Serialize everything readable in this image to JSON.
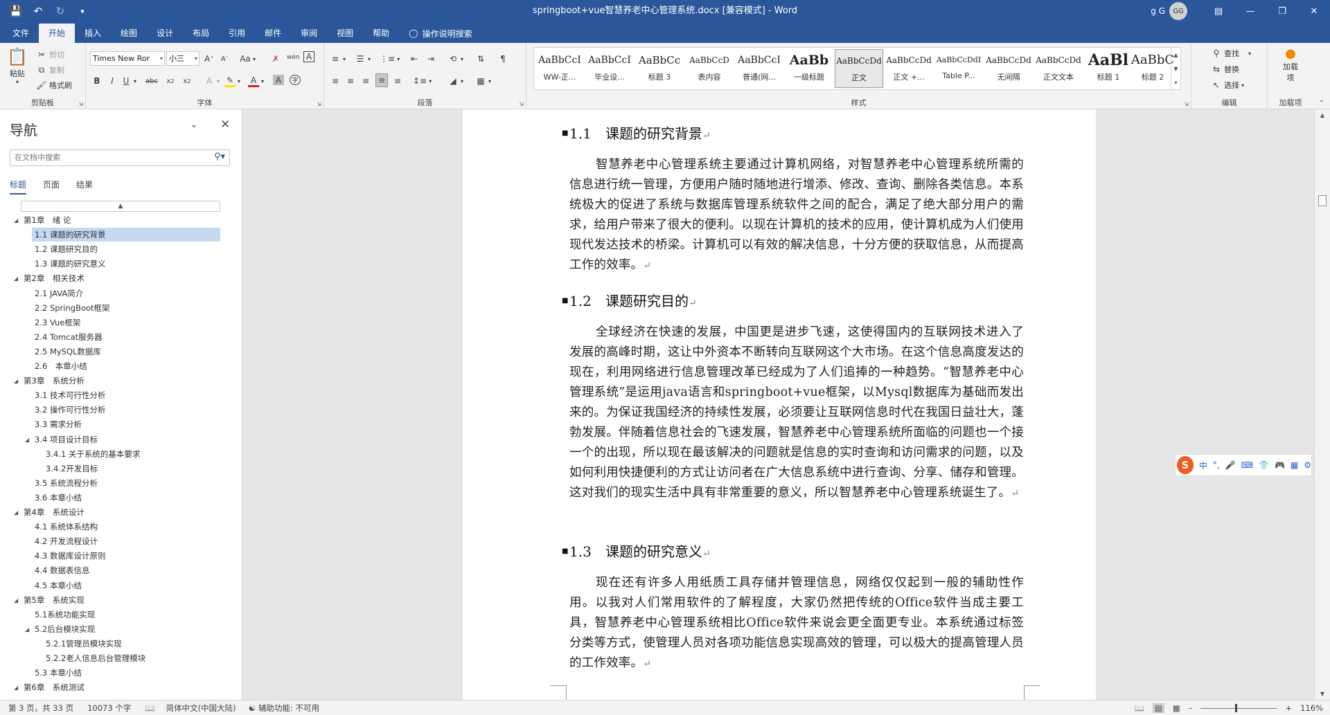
{
  "titlebar": {
    "doc_title": "springboot+vue智慧养老中心管理系统.docx [兼容模式] - Word",
    "user_name": "g G",
    "avatar_initials": "GG"
  },
  "ribbon_tabs": [
    "文件",
    "开始",
    "插入",
    "绘图",
    "设计",
    "布局",
    "引用",
    "邮件",
    "审阅",
    "视图",
    "帮助"
  ],
  "tell_me": "操作说明搜索",
  "clipboard": {
    "paste": "粘贴",
    "cut": "剪切",
    "copy": "复制",
    "format_painter": "格式刷",
    "label": "剪贴板"
  },
  "font": {
    "name": "Times New Ror",
    "size": "小三",
    "label": "字体",
    "change_case": "Aa",
    "pinyin": "wén"
  },
  "paragraph": {
    "label": "段落"
  },
  "styles": {
    "label": "样式",
    "items": [
      {
        "sample": "AaBbCcI",
        "name": "WW-正..."
      },
      {
        "sample": "AaBbCcI",
        "name": "毕业设..."
      },
      {
        "sample": "AaBbCc",
        "name": "标题 3"
      },
      {
        "sample": "AaBbCcD",
        "name": "表内容"
      },
      {
        "sample": "AaBbCcI",
        "name": "普通(网..."
      },
      {
        "sample": "AaBb",
        "name": "一级标题"
      },
      {
        "sample": "AaBbCcDd",
        "name": "正文"
      },
      {
        "sample": "AaBbCcDd",
        "name": "正文 +..."
      },
      {
        "sample": "AaBbCcDdI",
        "name": "Table P..."
      },
      {
        "sample": "AaBbCcDd",
        "name": "无间隔"
      },
      {
        "sample": "AaBbCcDd",
        "name": "正文文本"
      },
      {
        "sample": "AaBl",
        "name": "标题 1"
      },
      {
        "sample": "AaBbC",
        "name": "标题 2"
      }
    ],
    "selected_index": 6
  },
  "editing": {
    "find": "查找",
    "replace": "替换",
    "select": "选择",
    "label": "编辑"
  },
  "addins": {
    "button": "加载项",
    "label": "加载项"
  },
  "nav": {
    "title": "导航",
    "search_placeholder": "在文档中搜索",
    "tabs": [
      "标题",
      "页面",
      "结果"
    ],
    "items": [
      {
        "text": "第1章　绪 论",
        "level": 1,
        "expanded": true
      },
      {
        "text": "1.1 课题的研究背景",
        "level": 2,
        "selected": true
      },
      {
        "text": "1.2 课题研究目的",
        "level": 2
      },
      {
        "text": "1.3 课题的研究意义",
        "level": 2
      },
      {
        "text": "第2章　相关技术",
        "level": 1,
        "expanded": true
      },
      {
        "text": "2.1 JAVA简介",
        "level": 2
      },
      {
        "text": "2.2  SpringBoot框架",
        "level": 2
      },
      {
        "text": "2.3 Vue框架",
        "level": 2
      },
      {
        "text": "2.4 Tomcat服务器",
        "level": 2
      },
      {
        "text": "2.5 MySQL数据库",
        "level": 2
      },
      {
        "text": "2.6　本章小结",
        "level": 2
      },
      {
        "text": "第3章　系统分析",
        "level": 1,
        "expanded": true
      },
      {
        "text": "3.1 技术可行性分析",
        "level": 2
      },
      {
        "text": "3.2  操作可行性分析",
        "level": 2
      },
      {
        "text": "3.3 需求分析",
        "level": 2
      },
      {
        "text": "3.4 项目设计目标",
        "level": 2,
        "expanded": true
      },
      {
        "text": "3.4.1 关于系统的基本要求",
        "level": 3
      },
      {
        "text": "3.4.2开发目标",
        "level": 3
      },
      {
        "text": "3.5 系统流程分析",
        "level": 2
      },
      {
        "text": "3.6 本章小结",
        "level": 2
      },
      {
        "text": "第4章　系统设计",
        "level": 1,
        "expanded": true
      },
      {
        "text": "4.1 系统体系结构",
        "level": 2
      },
      {
        "text": "4.2  开发流程设计",
        "level": 2
      },
      {
        "text": "4.3  数据库设计原则",
        "level": 2
      },
      {
        "text": "4.4  数据表信息",
        "level": 2
      },
      {
        "text": "4.5  本章小结",
        "level": 2
      },
      {
        "text": "第5章　系统实现",
        "level": 1,
        "expanded": true
      },
      {
        "text": "5.1系统功能实现",
        "level": 2
      },
      {
        "text": "5.2后台模块实现",
        "level": 2,
        "expanded": true
      },
      {
        "text": "5.2.1管理员模块实现",
        "level": 3
      },
      {
        "text": "5.2.2老人信息后台管理模块",
        "level": 3
      },
      {
        "text": "5.3  本章小结",
        "level": 2
      },
      {
        "text": "第6章　系统测试",
        "level": 1,
        "expanded": true
      }
    ]
  },
  "document": {
    "sections": [
      {
        "num": "1.1",
        "title": "课题的研究背景",
        "body": "智慧养老中心管理系统主要通过计算机网络，对智慧养老中心管理系统所需的信息进行统一管理，方便用户随时随地进行增添、修改、查询、删除各类信息。本系统极大的促进了系统与数据库管理系统软件之间的配合，满足了绝大部分用户的需求，给用户带来了很大的便利。以现在计算机的技术的应用，使计算机成为人们使用现代发达技术的桥梁。计算机可以有效的解决信息，十分方便的获取信息，从而提高工作的效率。"
      },
      {
        "num": "1.2",
        "title": "课题研究目的",
        "body": "全球经济在快速的发展，中国更是进步飞速，这使得国内的互联网技术进入了发展的高峰时期，这让中外资本不断转向互联网这个大市场。在这个信息高度发达的现在，利用网络进行信息管理改革已经成为了人们追捧的一种趋势。“智慧养老中心管理系统”是运用java语言和springboot+vue框架，以Mysql数据库为基础而发出来的。为保证我国经济的持续性发展，必须要让互联网信息时代在我国日益壮大，蓬勃发展。伴随着信息社会的飞速发展，智慧养老中心管理系统所面临的问题也一个接一个的出现，所以现在最该解决的问题就是信息的实时查询和访问需求的问题，以及如何利用快捷便利的方式让访问者在广大信息系统中进行查询、分享、储存和管理。这对我们的现实生活中具有非常重要的意义，所以智慧养老中心管理系统诞生了。"
      },
      {
        "num": "1.3",
        "title": "课题的研究意义",
        "body": "现在还有许多人用纸质工具存储并管理信息，网络仅仅起到一般的辅助性作用。以我对人们常用软件的了解程度，大家仍然把传统的Office软件当成主要工具，智慧养老中心管理系统相比Office软件来说会更全面更专业。本系统通过标签分类等方式，使管理人员对各项功能信息实现高效的管理，可以极大的提高管理人员的工作效率。"
      }
    ],
    "para_mark": "↵"
  },
  "ime": {
    "mode": "中",
    "punct": "°,"
  },
  "statusbar": {
    "page": "第 3 页，共 33 页",
    "words": "10073 个字",
    "language": "简体中文(中国大陆)",
    "accessibility": "辅助功能: 不可用",
    "zoom": "116%"
  },
  "colors": {
    "accent": "#2b579a",
    "selected_nav": "#c5d9f1"
  }
}
